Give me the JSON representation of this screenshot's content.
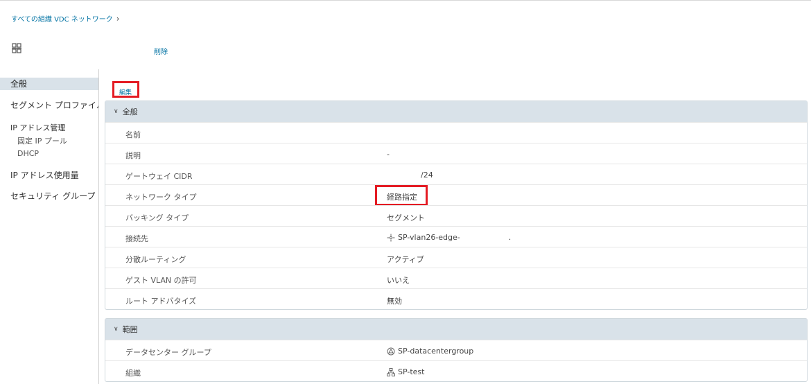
{
  "breadcrumb": {
    "label": "すべての組織 VDC ネットワーク",
    "chevron": "›"
  },
  "header": {
    "icon": "network-icon",
    "delete_label": "削除"
  },
  "sidebar": {
    "general": "全般",
    "segment_profile": "セグメント プロファイル",
    "ip_management": "IP アドレス管理",
    "static_ip_pool": "固定 IP プール",
    "dhcp": "DHCP",
    "ip_usage": "IP アドレス使用量",
    "security_group": "セキュリティ グループ"
  },
  "edit_label": "編集",
  "general_card": {
    "title": "全般",
    "rows": [
      {
        "key": "名前",
        "value": ""
      },
      {
        "key": "説明",
        "value": "-"
      },
      {
        "key": "ゲートウェイ CIDR",
        "value": "/24"
      },
      {
        "key": "ネットワーク タイプ",
        "value": "経路指定"
      },
      {
        "key": "バッキング タイプ",
        "value": "セグメント"
      },
      {
        "key": "接続先",
        "value": "SP-vlan26-edge-",
        "suffix": ".",
        "icon": "edge-gateway-icon"
      },
      {
        "key": "分散ルーティング",
        "value": "アクティブ"
      },
      {
        "key": "ゲスト VLAN の許可",
        "value": "いいえ"
      },
      {
        "key": "ルート アドバタイズ",
        "value": "無効"
      }
    ]
  },
  "scope_card": {
    "title": "範囲",
    "rows": [
      {
        "key": "データセンター グループ",
        "value": "SP-datacentergroup",
        "icon": "datacenter-group-icon"
      },
      {
        "key": "組織",
        "value": "SP-test",
        "icon": "organization-icon"
      }
    ]
  },
  "colors": {
    "link": "#0072a3",
    "highlight": "#e41b23",
    "header_bg": "#d9e2e9"
  }
}
